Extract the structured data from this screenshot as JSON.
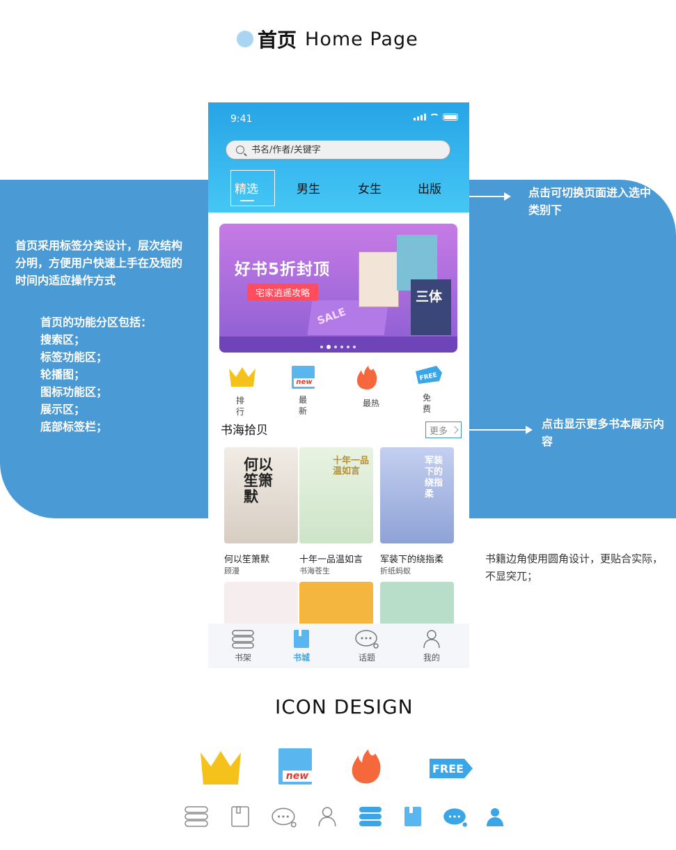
{
  "page_title": {
    "cn": "首页",
    "en": "Home  Page"
  },
  "notes": {
    "left_1": "首页采用标签分类设计，层次结构分明，方便用户快速上手在及短的时间内适应操作方式",
    "left_2_title": "首页的功能分区包括：",
    "left_2_items": [
      "搜索区；",
      "标签功能区；",
      "轮播图；",
      "图标功能区；",
      "展示区；",
      "底部标签栏；"
    ],
    "right_1": "点击可切换页面进入选中类别下",
    "right_2": "点击显示更多书本展示内容",
    "right_3": "书籍边角使用圆角设计，更贴合实际，不显突兀；"
  },
  "phone": {
    "status_time": "9:41",
    "search_placeholder": "书名/作者/关键字",
    "tabs": [
      "精选",
      "男生",
      "女生",
      "出版"
    ],
    "banner": {
      "title": "好书5折封顶",
      "subtitle": "宅家逍遥攻略",
      "book_label": "三体",
      "sale": "SALE",
      "dots_total": 6,
      "dots_active": 1
    },
    "features": [
      {
        "label": "排行",
        "icon": "crown-icon"
      },
      {
        "label": "最新",
        "icon": "new-book-icon"
      },
      {
        "label": "最热",
        "icon": "flame-icon"
      },
      {
        "label": "免费",
        "icon": "free-tag-icon"
      }
    ],
    "section_title": "书海拾贝",
    "more_label": "更多",
    "books": [
      {
        "title": "何以笙箫默",
        "author": "顾漫",
        "cover_text": "何以笙箫默"
      },
      {
        "title": "十年一品温如言",
        "author": "书海苍生",
        "cover_text": "十年一品温如言"
      },
      {
        "title": "军装下的绕指柔",
        "author": "折纸蚂蚁",
        "cover_text": "军装下的绕指柔"
      }
    ],
    "bottom_nav": [
      {
        "label": "书架",
        "active": false
      },
      {
        "label": "书城",
        "active": true
      },
      {
        "label": "话题",
        "active": false
      },
      {
        "label": "我的",
        "active": false
      }
    ],
    "free_text": "FREE",
    "new_text": "new"
  },
  "icon_design_title": "ICON DESIGN",
  "colors": {
    "accent_blue": "#4a9ad6",
    "header_blue": "#27a4e6",
    "icon_blue": "#5ab6ef",
    "crown_yellow": "#f4c21a",
    "flame_red": "#f4683b"
  }
}
